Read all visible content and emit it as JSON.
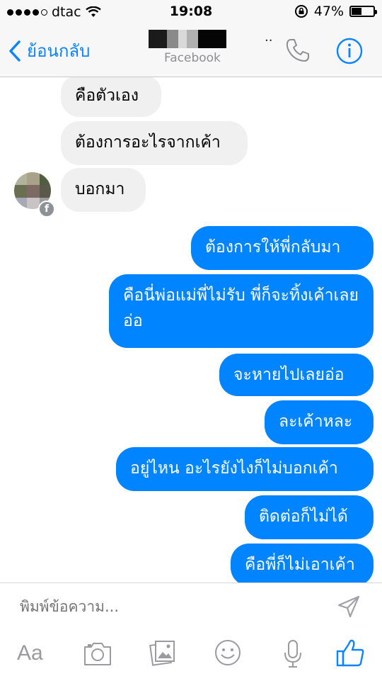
{
  "status_bar": {
    "carrier": "dtac",
    "time": "19:08",
    "battery_percent": "47%",
    "battery_level": 0.47
  },
  "navbar": {
    "back_label": "ย้อนกลับ",
    "contact_name_suffix": "..",
    "subtitle": "Facebook"
  },
  "messages": [
    {
      "side": "in",
      "text": "คือตัวเอง"
    },
    {
      "side": "in",
      "text": "ต้องการอะไรจากเค้า"
    },
    {
      "side": "in",
      "text": "บอกมา"
    },
    {
      "side": "out",
      "text": "ต้องการให้พี่กลับมา"
    },
    {
      "side": "out",
      "text": "คือนี่พ่อแม่พี่ไม่รับ พี่ก็จะทิ้งเค้าเลยอ่อ"
    },
    {
      "side": "out",
      "text": "จะหายไปเลยอ่อ"
    },
    {
      "side": "out",
      "text": "ละเค้าหละ"
    },
    {
      "side": "out",
      "text": "อยู่ไหน อะไรยังไงก็ไม่บอกเค้า"
    },
    {
      "side": "out",
      "text": "ติดต่อก็ไม่ได้"
    },
    {
      "side": "out",
      "text": "คือพี่ก็ไม่เอาเค้า"
    }
  ],
  "avatar_badge": "f",
  "composer": {
    "placeholder": "พิมพ์ข้อความ...",
    "text_button": "Aa"
  },
  "colors": {
    "accent": "#0a84ff",
    "outgoing_bubble": "#0084ff",
    "incoming_bubble": "#f1f0f0"
  },
  "icons": [
    "signal-dots-icon",
    "wifi-icon",
    "rotation-lock-icon",
    "battery-icon",
    "back-chevron-icon",
    "phone-icon",
    "info-icon",
    "send-icon",
    "camera-icon",
    "gallery-icon",
    "emoji-icon",
    "microphone-icon",
    "like-thumb-icon"
  ]
}
